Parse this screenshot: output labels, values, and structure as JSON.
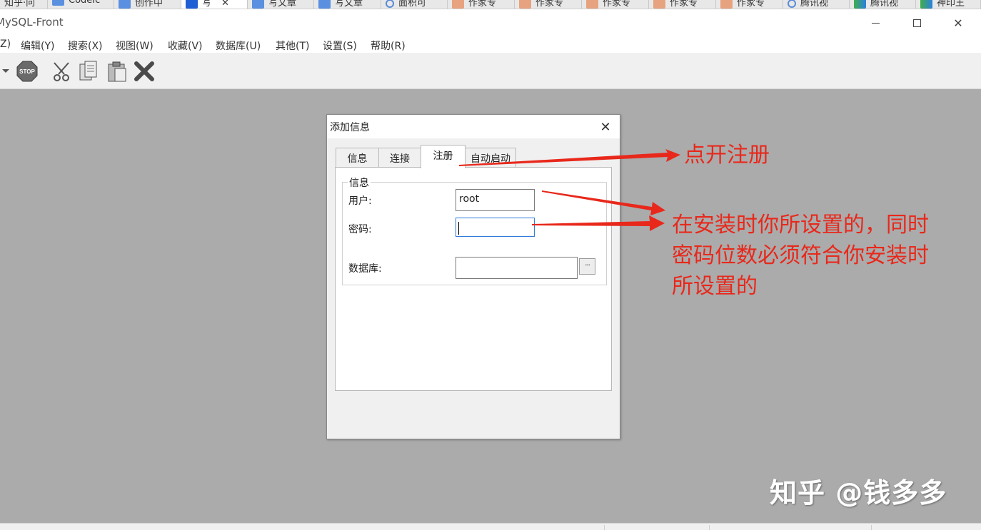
{
  "browser_tabs": [
    {
      "label": "知乎·问",
      "icon": "search-icon"
    },
    {
      "label": "CodeIc",
      "icon": "zhihu-icon"
    },
    {
      "label": "创作中",
      "icon": "zhihu-icon"
    },
    {
      "label": "写",
      "icon": "zhihu-icon",
      "active": true
    },
    {
      "label": "写文章",
      "icon": "zhihu-icon"
    },
    {
      "label": "写文章",
      "icon": "zhihu-icon"
    },
    {
      "label": "面积可",
      "icon": "search-icon"
    },
    {
      "label": "作家专",
      "icon": "wzl-icon"
    },
    {
      "label": "作家专",
      "icon": "wzl-icon"
    },
    {
      "label": "作家专",
      "icon": "wzl-icon"
    },
    {
      "label": "作家专",
      "icon": "wzl-icon"
    },
    {
      "label": "作家专",
      "icon": "wzl-icon"
    },
    {
      "label": "腾讯视",
      "icon": "search-icon"
    },
    {
      "label": "腾讯视",
      "icon": "tencent-video-icon"
    },
    {
      "label": "神印王",
      "icon": "tencent-video-icon"
    }
  ],
  "app": {
    "title": "MySQL-Front"
  },
  "menu": [
    "Z)",
    "编辑(Y)",
    "搜索(X)",
    "视图(W)",
    "收藏(V)",
    "数据库(U)",
    "其他(T)",
    "设置(S)",
    "帮助(R)"
  ],
  "toolbar": {
    "icons": [
      "stop-icon",
      "cut-icon",
      "copy-icon",
      "paste-icon",
      "delete-icon"
    ],
    "stop_label": "STOP"
  },
  "dialog": {
    "title": "添加信息",
    "close_glyph": "✕",
    "tabs": [
      "信息",
      "连接",
      "注册",
      "自动启动"
    ],
    "active_tab": "注册",
    "group_title": "信息",
    "fields": {
      "user": {
        "label": "用户:",
        "value": "root"
      },
      "password": {
        "label": "密码:",
        "value": ""
      },
      "database": {
        "label": "数据库:",
        "value": "",
        "browse_label": "···"
      }
    }
  },
  "annotations": {
    "tab_hint": "点开注册",
    "password_hint_lines": [
      "在安装时你所设置的，同时",
      "密码位数必须符合你安装时",
      "所设置的"
    ],
    "arrow_color": "#e8281b"
  },
  "watermark": "知乎 @钱多多"
}
